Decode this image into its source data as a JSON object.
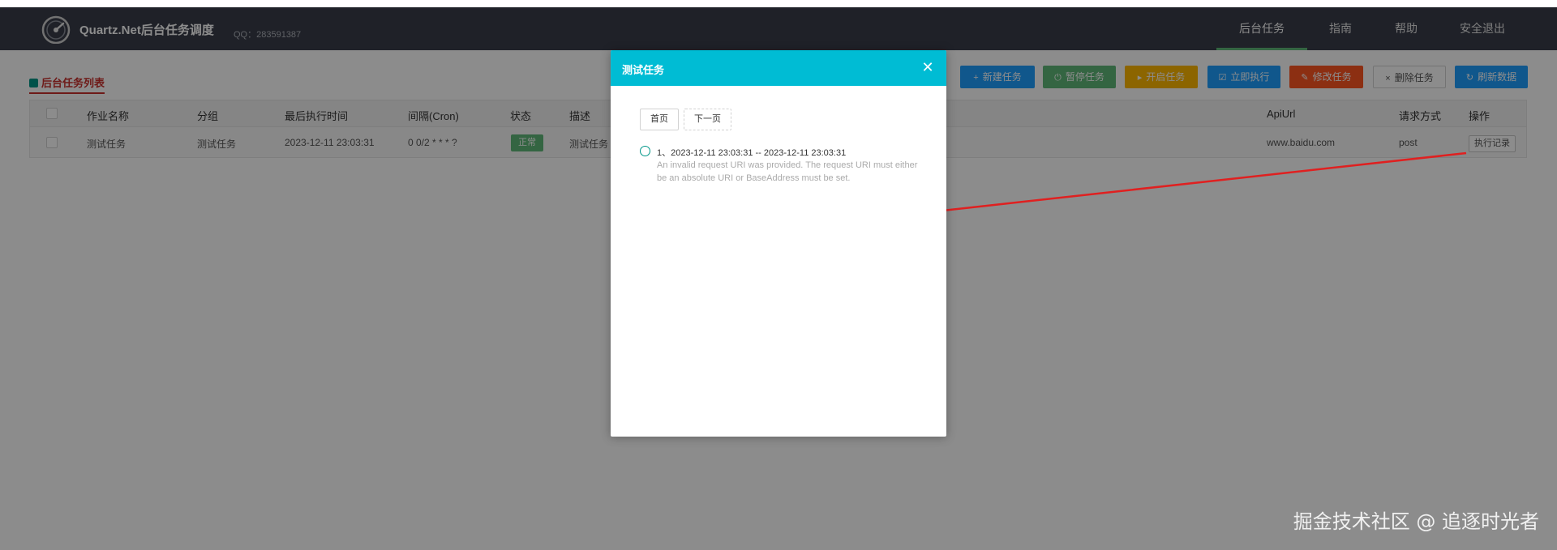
{
  "header": {
    "brand": "Quartz.Net后台任务调度",
    "qq": "QQ：283591387",
    "nav": [
      {
        "label": "后台任务",
        "active": true
      },
      {
        "label": "指南"
      },
      {
        "label": "帮助"
      },
      {
        "label": "安全退出"
      }
    ]
  },
  "section_title": "后台任务列表",
  "toolbar": [
    {
      "label": "新建任务",
      "icon": "+",
      "color": "#1E9FFF"
    },
    {
      "label": "暂停任务",
      "icon": "⏻",
      "color": "#5FB878"
    },
    {
      "label": "开启任务",
      "icon": "▸",
      "color": "#FFB800"
    },
    {
      "label": "立即执行",
      "icon": "☑",
      "color": "#1E9FFF"
    },
    {
      "label": "修改任务",
      "icon": "✎",
      "color": "#FF5722"
    },
    {
      "label": "删除任务",
      "icon": "×",
      "color": "#ffffff"
    },
    {
      "label": "刷新数据",
      "icon": "↻",
      "color": "#1E9FFF"
    }
  ],
  "table": {
    "columns": [
      "作业名称",
      "分组",
      "最后执行时间",
      "间隔(Cron)",
      "状态",
      "描述",
      "ApiUrl",
      "请求方式",
      "操作"
    ],
    "rows": [
      {
        "name": "测试任务",
        "group": "测试任务",
        "last_run": "2023-12-11 23:03:31",
        "cron": "0 0/2 * * * ?",
        "status": "正常",
        "description": "测试任务",
        "api_url": "www.baidu.com",
        "method": "post",
        "action": "执行记录"
      }
    ]
  },
  "modal": {
    "title": "测试任务",
    "pager": [
      "首页",
      "下一页"
    ],
    "log": {
      "time": "1、2023-12-11 23:03:31 -- 2023-12-11 23:03:31",
      "message": "An invalid request URI was provided. The request URI must either be an absolute URI or BaseAddress must be set."
    }
  },
  "watermark": "掘金技术社区 @ 追逐时光者",
  "colors": {
    "header_bg": "#393D49",
    "modal_header": "#00bcd4",
    "status_ok": "#5FB878",
    "accent_red": "#c9302c",
    "annotation_arrow": "#e02020"
  }
}
